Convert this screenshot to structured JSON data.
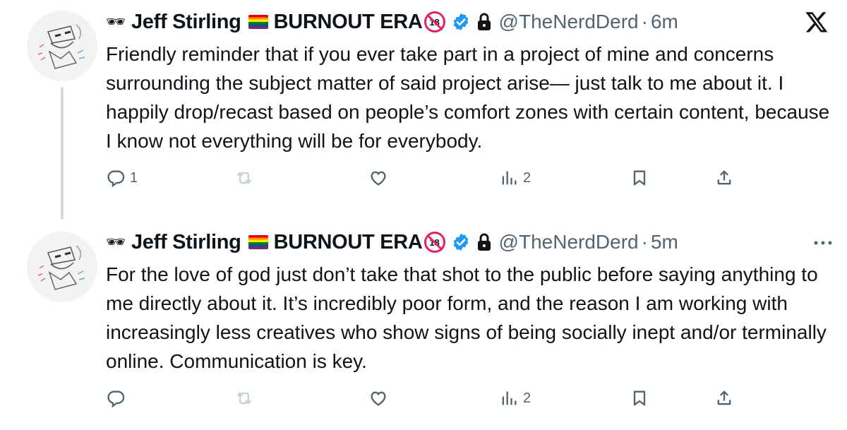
{
  "tweets": [
    {
      "prefix_emoji": "🕶",
      "display_name": "Jeff Stirling",
      "name_suffix": "BURNOUT ERA",
      "badge_text": "18",
      "handle": "@TheNerdDerd",
      "separator": "·",
      "time": "6m",
      "text": "Friendly reminder that if you ever take part in a project of mine and concerns surrounding the subject matter of said project arise— just talk to me about it. I happily drop/recast based on people’s comfort zones with certain content, because I know not everything will be for everybody.",
      "replies": "1",
      "retweets": "",
      "likes": "",
      "views": "2"
    },
    {
      "prefix_emoji": "🕶",
      "display_name": "Jeff Stirling",
      "name_suffix": "BURNOUT ERA",
      "badge_text": "18",
      "handle": "@TheNerdDerd",
      "separator": "·",
      "time": "5m",
      "text": "For the love of god just don’t take that shot to the public before saying anything to me directly about it. It’s incredibly poor form, and the reason I am working with increasingly less creatives who show signs of being socially inept and/or terminally online. Communication is key.",
      "replies": "",
      "retweets": "",
      "likes": "",
      "views": "2"
    }
  ],
  "top_right": {
    "logo_icon": "x-logo-icon",
    "more_label": "···"
  },
  "colors": {
    "text": "#0f1419",
    "muted": "#536471",
    "verified": "#1d9bf0",
    "thread_line": "#cfd9de"
  }
}
